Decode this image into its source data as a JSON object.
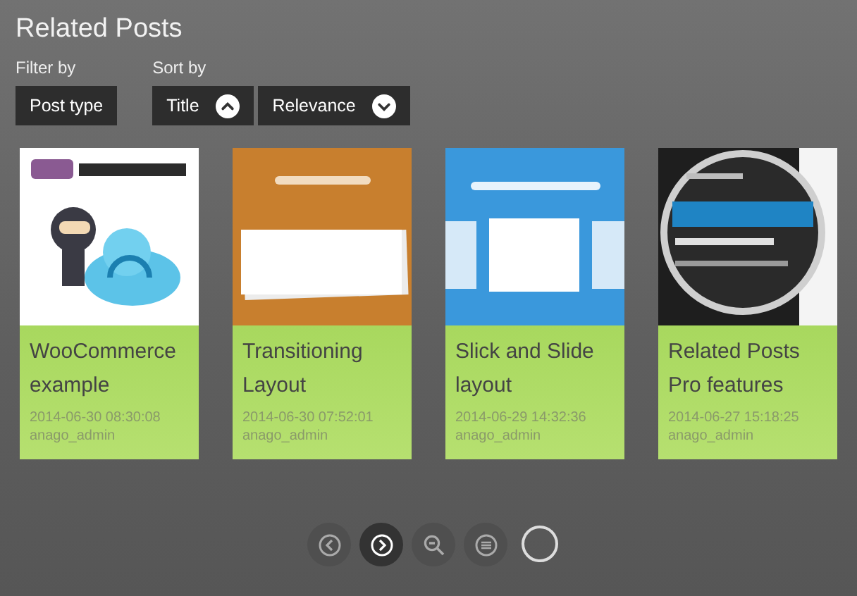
{
  "title": "Related Posts",
  "filter": {
    "label": "Filter by",
    "buttons": [
      {
        "label": "Post type"
      }
    ]
  },
  "sort": {
    "label": "Sort by",
    "buttons": [
      {
        "label": "Title",
        "kind": "up"
      },
      {
        "label": "Relevance",
        "kind": "down"
      }
    ]
  },
  "posts": [
    {
      "title": "WooCommerce example",
      "date": "2014-06-30 08:30:08",
      "author": "anago_admin"
    },
    {
      "title": "Transitioning Layout",
      "date": "2014-06-30 07:52:01",
      "author": "anago_admin"
    },
    {
      "title": "Slick and Slide layout",
      "date": "2014-06-29 14:32:36",
      "author": "anago_admin"
    },
    {
      "title": "Related Posts Pro features",
      "date": "2014-06-27 15:18:25",
      "author": "anago_admin"
    }
  ],
  "nav": [
    {
      "kind": "prev",
      "active": false
    },
    {
      "kind": "next",
      "active": true
    },
    {
      "kind": "zoom",
      "active": false
    },
    {
      "kind": "list",
      "active": false
    },
    {
      "kind": "ring",
      "active": false
    }
  ]
}
